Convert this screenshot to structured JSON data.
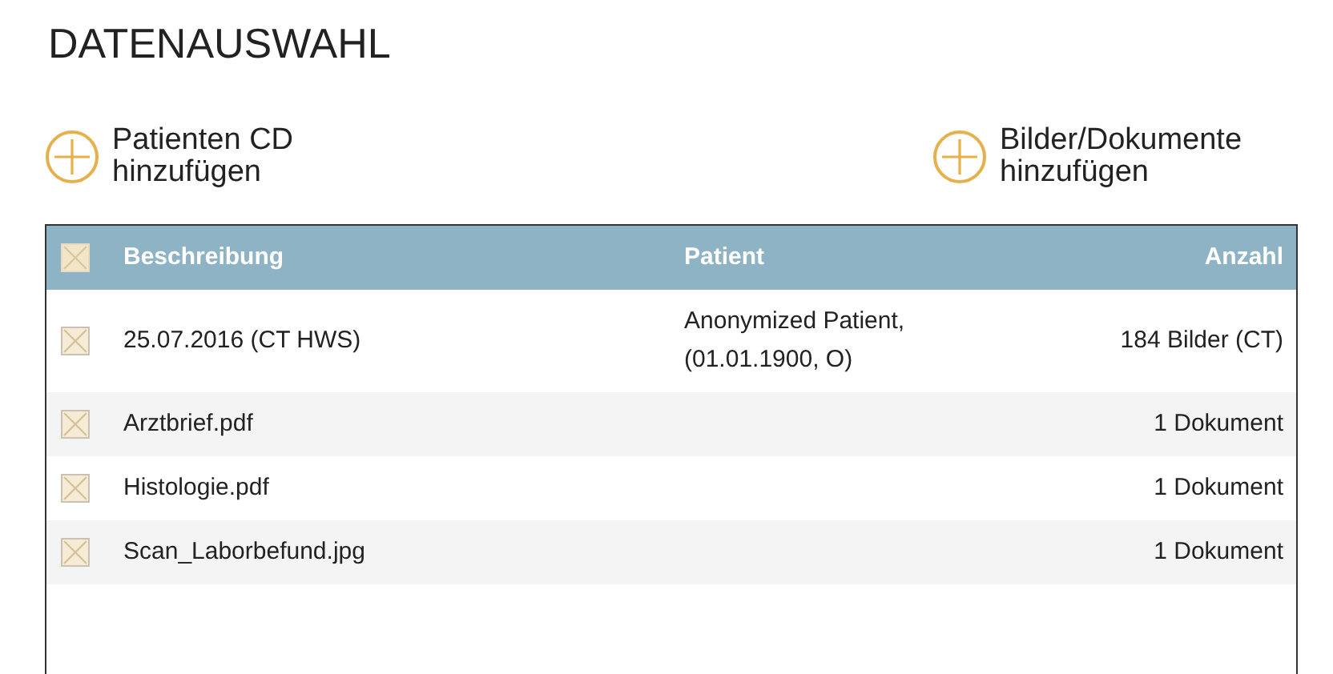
{
  "title": "DATENAUSWAHL",
  "actions": [
    {
      "label": "Patienten CD hinzufügen"
    },
    {
      "label": "Bilder/Dokumente hinzufügen"
    }
  ],
  "table": {
    "header_checked": true,
    "columns": [
      "Beschreibung",
      "Patient",
      "Anzahl"
    ],
    "rows": [
      {
        "checked": true,
        "cells": [
          "25.07.2016 (CT HWS)",
          "Anonymized Patient,\n(01.01.1900, O)",
          "184 Bilder (CT)"
        ]
      },
      {
        "checked": true,
        "cells": [
          "Arztbrief.pdf",
          "",
          "1 Dokument"
        ]
      },
      {
        "checked": true,
        "cells": [
          "Histologie.pdf",
          "",
          "1 Dokument"
        ]
      },
      {
        "checked": true,
        "cells": [
          "Scan_Laborbefund.jpg",
          "",
          "1 Dokument"
        ]
      }
    ]
  }
}
